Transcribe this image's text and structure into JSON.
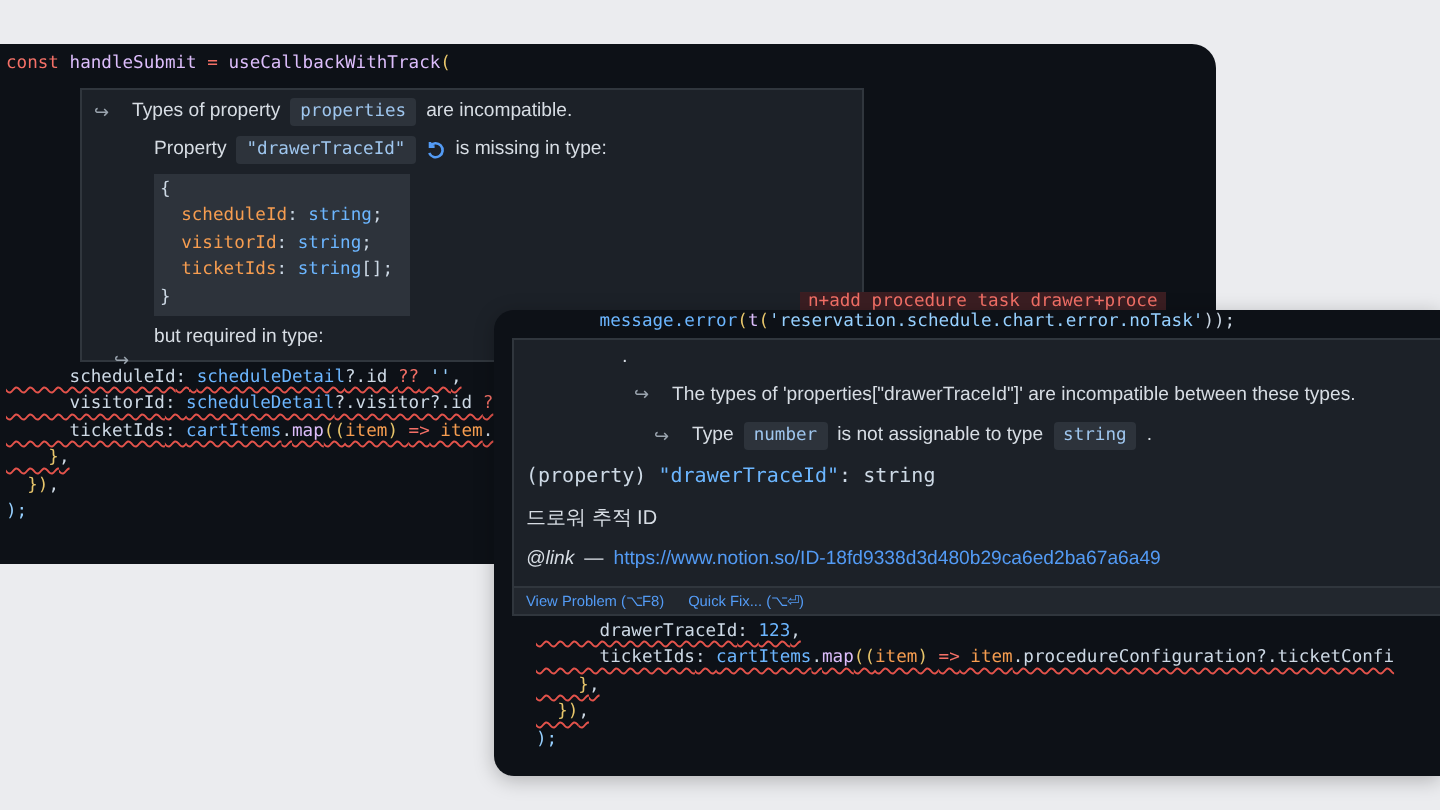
{
  "back_window": {
    "top_code": [
      {
        "tokens": [
          {
            "text": "const",
            "kind": "keyword"
          },
          {
            "text": " handleSubmit ",
            "kind": "function"
          },
          {
            "text": "=",
            "kind": "operator"
          },
          {
            "text": " useCallbackWithTrack",
            "kind": "function"
          },
          {
            "text": "(",
            "kind": "bracket"
          }
        ],
        "error": false
      }
    ],
    "error_fragment": "n+add procedure task drawer+proce",
    "hover": {
      "heading": {
        "arrow": "↪",
        "before": "Types of property",
        "code": "properties",
        "after": "are incompatible."
      },
      "missing": {
        "before": "Property",
        "code": "\"drawerTraceId\"",
        "after": "is missing in type:"
      },
      "type_block": [
        {
          "tokens": [
            {
              "text": "{",
              "kind": "plain"
            }
          ]
        },
        {
          "tokens": [
            {
              "text": "  scheduleId",
              "kind": "param"
            },
            {
              "text": ": ",
              "kind": "plain"
            },
            {
              "text": "string",
              "kind": "type"
            },
            {
              "text": ";",
              "kind": "plain"
            }
          ]
        },
        {
          "tokens": [
            {
              "text": "  visitorId",
              "kind": "param"
            },
            {
              "text": ": ",
              "kind": "plain"
            },
            {
              "text": "string",
              "kind": "type"
            },
            {
              "text": ";",
              "kind": "plain"
            }
          ]
        },
        {
          "tokens": [
            {
              "text": "  ticketIds",
              "kind": "param"
            },
            {
              "text": ": ",
              "kind": "plain"
            },
            {
              "text": "string",
              "kind": "type"
            },
            {
              "text": "[];",
              "kind": "plain"
            }
          ]
        },
        {
          "tokens": [
            {
              "text": "}",
              "kind": "plain"
            }
          ]
        }
      ],
      "required": "but required in type:",
      "arrow": "↪"
    },
    "code": [
      {
        "tokens": [
          {
            "text": "      scheduleId",
            "kind": "plain"
          },
          {
            "text": ": ",
            "kind": "plain"
          },
          {
            "text": "scheduleDetail",
            "kind": "value"
          },
          {
            "text": "?.id ",
            "kind": "plain"
          },
          {
            "text": "??",
            "kind": "keyword"
          },
          {
            "text": " ''",
            "kind": "string"
          },
          {
            "text": ",",
            "kind": "plain"
          }
        ],
        "error": true
      },
      {
        "tokens": [
          {
            "text": "      visitorId",
            "kind": "plain"
          },
          {
            "text": ": ",
            "kind": "plain"
          },
          {
            "text": "scheduleDetail",
            "kind": "value"
          },
          {
            "text": "?.visitor?.id ",
            "kind": "plain"
          },
          {
            "text": "?",
            "kind": "keyword"
          }
        ],
        "error": true
      },
      {
        "tokens": [
          {
            "text": "      ticketIds",
            "kind": "plain"
          },
          {
            "text": ": ",
            "kind": "plain"
          },
          {
            "text": "cartItems",
            "kind": "value"
          },
          {
            "text": ".",
            "kind": "plain"
          },
          {
            "text": "map",
            "kind": "function"
          },
          {
            "text": "((",
            "kind": "bracket"
          },
          {
            "text": "item",
            "kind": "param"
          },
          {
            "text": ") ",
            "kind": "bracket"
          },
          {
            "text": "=>",
            "kind": "keyword"
          },
          {
            "text": " item",
            "kind": "param"
          },
          {
            "text": ".",
            "kind": "plain"
          }
        ],
        "error": true
      },
      {
        "tokens": [
          {
            "text": "    }",
            "kind": "bracket"
          },
          {
            "text": ",",
            "kind": "plain"
          }
        ],
        "error": true
      },
      {
        "tokens": [
          {
            "text": "  })",
            "kind": "bracket"
          },
          {
            "text": ",",
            "kind": "plain"
          }
        ],
        "error": false
      },
      {
        "tokens": [
          {
            "text": ");",
            "kind": "string"
          }
        ],
        "error": false
      }
    ]
  },
  "front_window": {
    "top_code": [
      {
        "tokens": [
          {
            "text": "      message.error",
            "kind": "value"
          },
          {
            "text": "(",
            "kind": "bracket"
          },
          {
            "text": "t",
            "kind": "function"
          },
          {
            "text": "(",
            "kind": "bracket"
          },
          {
            "text": "'reservation.schedule.chart.error.noTask'",
            "kind": "string"
          },
          {
            "text": "));",
            "kind": "plain"
          }
        ],
        "error": false
      }
    ],
    "hover": {
      "dot": ".",
      "incompatible": {
        "arrow": "↪",
        "text": "The types of 'properties[\"drawerTraceId\"]' are incompatible between these types."
      },
      "assignable": {
        "arrow": "↪",
        "before": "Type",
        "code_1": "number",
        "middle": "is not assignable to type",
        "code_2": "string",
        "after": "."
      },
      "signature": [
        {
          "text": "(property) ",
          "kind": "plain"
        },
        {
          "text": "\"drawerTraceId\"",
          "kind": "value"
        },
        {
          "text": ": string",
          "kind": "plain"
        }
      ],
      "description": "드로워 추적 ID",
      "link": {
        "tag": "@link",
        "dash": "—",
        "url": "https://www.notion.so/ID-18fd9338d3d480b29ca6ed2ba67a6a49"
      },
      "actions": [
        "View Problem (⌥F8)",
        "Quick Fix... (⌥⏎)"
      ]
    },
    "code": [
      {
        "tokens": [
          {
            "text": "      drawerTraceId",
            "kind": "plain"
          },
          {
            "text": ": ",
            "kind": "plain"
          },
          {
            "text": "123",
            "kind": "value"
          },
          {
            "text": ",",
            "kind": "plain"
          }
        ],
        "error": true
      },
      {
        "tokens": [
          {
            "text": "      ticketIds",
            "kind": "plain"
          },
          {
            "text": ": ",
            "kind": "plain"
          },
          {
            "text": "cartItems",
            "kind": "value"
          },
          {
            "text": ".",
            "kind": "plain"
          },
          {
            "text": "map",
            "kind": "function"
          },
          {
            "text": "((",
            "kind": "bracket"
          },
          {
            "text": "item",
            "kind": "param"
          },
          {
            "text": ") ",
            "kind": "bracket"
          },
          {
            "text": "=>",
            "kind": "keyword"
          },
          {
            "text": " item",
            "kind": "param"
          },
          {
            "text": ".procedureConfiguration?.ticketConfi",
            "kind": "plain"
          }
        ],
        "error": true
      },
      {
        "tokens": [
          {
            "text": "    }",
            "kind": "bracket"
          },
          {
            "text": ",",
            "kind": "plain"
          }
        ],
        "error": true
      },
      {
        "tokens": [
          {
            "text": "  })",
            "kind": "bracket"
          },
          {
            "text": ",",
            "kind": "plain"
          }
        ],
        "error": true
      },
      {
        "tokens": [
          {
            "text": ");",
            "kind": "string"
          }
        ],
        "error": false
      }
    ]
  }
}
